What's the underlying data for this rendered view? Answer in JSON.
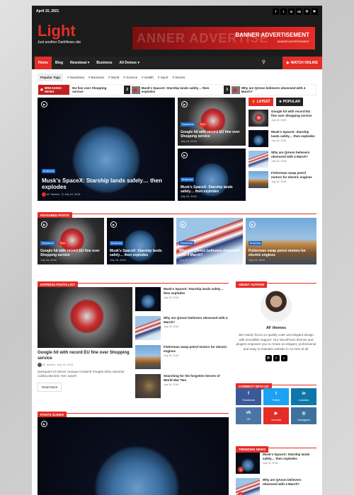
{
  "topbar": {
    "date": "April 15, 2021",
    "socials": [
      "f",
      "t",
      "in",
      "vk",
      "◎",
      "▶"
    ]
  },
  "site": {
    "title": "Light",
    "tagline": "Just another DarkNews site"
  },
  "ad": {
    "ghost": "ANNER ADVERTISE",
    "title": "BANNER ADVERTISEMENT",
    "sub": "BANNER ADVERTISEMENT"
  },
  "nav": {
    "items": [
      "Home",
      "Blog",
      "Newsbeat ▾",
      "Business",
      "All Demos ▾"
    ],
    "watch": "WATCH ONLINE"
  },
  "popular_tags": {
    "label": "Popular Tags",
    "tags": [
      "# Newsbeat",
      "# Business",
      "# World",
      "# Science",
      "# Health",
      "# Sport",
      "# Stories"
    ]
  },
  "breaking": {
    "label": "BREAKING NEWS",
    "items": [
      {
        "num": "",
        "text": "EU fine over Shopping service"
      },
      {
        "num": "2",
        "text": "Musk's SpaceX: Starship lands safely… then explodes"
      },
      {
        "num": "3",
        "text": "Why are QAnon believers obsessed with 4 March?"
      }
    ]
  },
  "hero": {
    "category": "Business",
    "title": "Musk's SpaceX: Starship lands safely… then explodes",
    "author": "AF themes",
    "date": "July 18, 2018"
  },
  "mid_top": {
    "cats": [
      "Newsbeat",
      "Tech"
    ],
    "title": "Google hit with record EU fine over Shopping service",
    "date": "July 18, 2018"
  },
  "mid_bottom": {
    "cat": "Business",
    "title": "Musk's SpaceX: Starship lands safely… then explodes",
    "date": "July 18, 2018"
  },
  "sidebar_tabs": {
    "latest": "LATEST",
    "popular": "POPULAR"
  },
  "sidebar_list": [
    {
      "title": "Google hit with record EU fine over Shopping service",
      "date": "July 18, 2018"
    },
    {
      "title": "Musk's SpaceX: Starship lands safely… then explodes",
      "date": "July 18, 2018"
    },
    {
      "title": "Why are QAnon believers obsessed with 4 March?",
      "date": "July 18, 2018"
    },
    {
      "title": "Fisherman swap petrol motors for electric engines",
      "date": "July 18, 2018"
    }
  ],
  "featured": {
    "label": "FEATURED POSTS",
    "items": [
      {
        "cats": [
          "Newsbeat",
          "Tech"
        ],
        "title": "Google hit with record EU fine over Shopping service",
        "date": "July 18, 2018"
      },
      {
        "cats": [
          "Business"
        ],
        "title": "Musk's SpaceX: Starship lands safely… then explodes",
        "date": "July 18, 2018"
      },
      {
        "cats": [
          "Newsbeat"
        ],
        "title": "Why are QAnon believers obsessed with 4 March?",
        "date": "July 18, 2018"
      },
      {
        "cats": [
          "Business"
        ],
        "title": "Fisherman swap petrol motors for electric engines",
        "date": "July 18, 2018"
      }
    ]
  },
  "express": {
    "label": "EXPRESS POSTS LIST",
    "main": {
      "title": "Google hit with record EU fine over Shopping service",
      "author": "AF themes",
      "date": "July 18, 2018",
      "excerpt": "Quisquam id rutrum cumque incidunt! Feugiat dicta nascetur cubilia placerat. Nec turpis!",
      "read_more": "Read More"
    },
    "list": [
      {
        "title": "Musk's SpaceX: Starship lands safely… then explodes",
        "date": "July 18, 2018"
      },
      {
        "title": "Why are QAnon believers obsessed with 4 March?",
        "date": "July 18, 2018"
      },
      {
        "title": "Fisherman swap petrol motors for electric engines",
        "date": "July 18, 2018"
      },
      {
        "title": "Searching for the forgotten heroes of World War Two",
        "date": "July 18, 2018"
      }
    ]
  },
  "about": {
    "label": "ABOUT AUTHOR",
    "name": "AF themes",
    "bio": "We mainly focus on quality code and elegant design with incredible support. Our WordPress themes and plugins empower you to create an elegant, professional and easy to maintain website in no time at all."
  },
  "connect": {
    "label": "CONNECT WITH US",
    "items": [
      {
        "name": "Facebook",
        "icon": "f",
        "color": "#3b5998"
      },
      {
        "name": "Twitter",
        "icon": "t",
        "color": "#1da1f2"
      },
      {
        "name": "Linkedin",
        "icon": "in",
        "color": "#0e76a8"
      },
      {
        "name": "VK",
        "icon": "vk",
        "color": "#4c75a3"
      },
      {
        "name": "Youtube",
        "icon": "▶",
        "color": "#e52d27"
      },
      {
        "name": "Instagram",
        "icon": "◎",
        "color": "#3f729b"
      }
    ]
  },
  "slider": {
    "label": "POSTS SLIDER"
  },
  "trending": {
    "label": "TRENDING NEWS",
    "items": [
      {
        "num": "2",
        "title": "Musk's SpaceX: Starship lands safely… then explodes",
        "date": "July 18, 2018"
      },
      {
        "num": "3",
        "title": "Why are QAnon believers obsessed with 4 March?",
        "date": ""
      }
    ]
  }
}
